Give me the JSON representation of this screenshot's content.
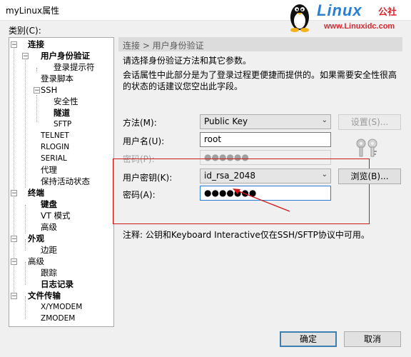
{
  "window": {
    "title": "myLinux属性"
  },
  "watermark": {
    "brand": "Linux",
    "brand_cn": "公社",
    "url": "www.Linuxidc.com"
  },
  "category_label": "类别(C):",
  "tree": [
    {
      "label": "连接",
      "bold": true
    },
    {
      "label": "用户身份验证",
      "bold": true
    },
    {
      "label": "登录提示符",
      "bold": false
    },
    {
      "label": "登录脚本",
      "bold": false
    },
    {
      "label": "SSH",
      "bold": false
    },
    {
      "label": "安全性",
      "bold": false
    },
    {
      "label": "隧道",
      "bold": true
    },
    {
      "label": "SFTP",
      "bold": false
    },
    {
      "label": "TELNET",
      "bold": false
    },
    {
      "label": "RLOGIN",
      "bold": false
    },
    {
      "label": "SERIAL",
      "bold": false
    },
    {
      "label": "代理",
      "bold": false
    },
    {
      "label": "保持活动状态",
      "bold": false
    },
    {
      "label": "终端",
      "bold": true
    },
    {
      "label": "键盘",
      "bold": true
    },
    {
      "label": "VT 模式",
      "bold": false
    },
    {
      "label": "高级",
      "bold": false
    },
    {
      "label": "外观",
      "bold": true
    },
    {
      "label": "边距",
      "bold": false
    },
    {
      "label": "高级",
      "bold": false
    },
    {
      "label": "跟踪",
      "bold": false
    },
    {
      "label": "日志记录",
      "bold": true
    },
    {
      "label": "文件传输",
      "bold": true
    },
    {
      "label": "X/YMODEM",
      "bold": false
    },
    {
      "label": "ZMODEM",
      "bold": false
    }
  ],
  "panel": {
    "header": "连接 > 用户身份验证",
    "desc1": "请选择身份验证方法和其它参数。",
    "desc2": "会话属性中此部分是为了登录过程更便捷而提供的。如果需要安全性很高",
    "desc3": "的状态的话建议您空出此字段。",
    "method_label": "方法(M):",
    "method_value": "Public Key",
    "settings_button": "设置(S)...",
    "username_label": "用户名(U):",
    "username_value": "root",
    "password_label_disabled": "密码(P):",
    "password_disabled_value": "●●●●●●",
    "user_key_label": "用户密钥(K):",
    "user_key_value": "id_rsa_2048",
    "browse_button": "浏览(B)...",
    "passphrase_label": "密码(A):",
    "passphrase_value": "●●●●●●●",
    "note": "注释: 公钥和Keyboard Interactive仅在SSH/SFTP协议中可用。"
  },
  "footer": {
    "ok": "确定",
    "cancel": "取消"
  },
  "colors": {
    "highlight": "#d01a1a",
    "brand_blue": "#2a7fd4",
    "brand_red": "#d8262e"
  }
}
